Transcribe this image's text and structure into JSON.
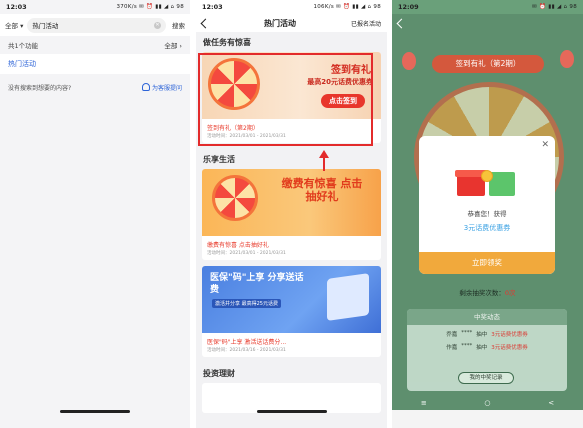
{
  "screen1": {
    "status": {
      "time": "12:03",
      "icons": "370K/s ✉ ⏰ ▮▮ ◢ ⌂ 98"
    },
    "search": {
      "scope": "全部",
      "query": "热门活动",
      "button": "搜索"
    },
    "result_count": "共1个功能",
    "filter": "全部",
    "result_item": "热门活动",
    "feedback": {
      "prompt": "没有搜索到想要的内容?",
      "link": "为客服提问"
    }
  },
  "screen2": {
    "status": {
      "time": "12:03",
      "icons": "106K/s ✉ ⏰ ▮▮ ◢ ⌂ 98"
    },
    "nav": {
      "title": "热门活动",
      "right": "已报名活动"
    },
    "sections": [
      {
        "title": "做任务有惊喜"
      },
      {
        "title": "乐享生活"
      },
      {
        "title": "投资理财"
      }
    ],
    "cards": [
      {
        "banner_title": "签到有礼",
        "banner_sub": "最高20元话费优惠券",
        "banner_button": "点击签到",
        "name": "签到有礼（第2期）",
        "date": "活动时间：2021/03/01 - 2021/03/31"
      },
      {
        "banner_title": "缴费有惊喜 点击抽好礼",
        "name": "缴费有惊喜 点击抽好礼",
        "date": "活动时间：2021/03/01 - 2021/03/31"
      },
      {
        "banner_title": "医保\"码\"上享 分享送话费",
        "banner_sub": "激活并分享 最高得25元话费",
        "name": "医保\"码\"上享 激活送话费分...",
        "date": "活动时间：2021/03/16 - 2021/03/31"
      }
    ]
  },
  "screen3": {
    "status": {
      "time": "12:09",
      "icons": "✉ ⏰ ▮▮ ◢ ⌂ 98"
    },
    "title": "签到有礼（第2期）",
    "modal": {
      "congrats": "恭喜您！获得",
      "prize": "3元话费优惠券",
      "button": "立即领奖"
    },
    "chances_label": "剩余抽奖次数：",
    "chances_value": "0次",
    "winners": {
      "title": "中奖动态",
      "rows": [
        {
          "name": "乔嘉",
          "mask": "****",
          "text": "抽中",
          "amount": "3元话费优惠券"
        },
        {
          "name": "作嘉",
          "mask": "****",
          "text": "抽中",
          "amount": "3元话费优惠券"
        }
      ],
      "record_button": "我的中奖记录"
    },
    "softkeys": [
      "≡",
      "○",
      "<"
    ]
  },
  "colors": {
    "brand_blue": "#2d64d8",
    "highlight_red": "#e32b2b",
    "claim_orange": "#f1a93c",
    "bg_green": "#5e8f6e"
  }
}
